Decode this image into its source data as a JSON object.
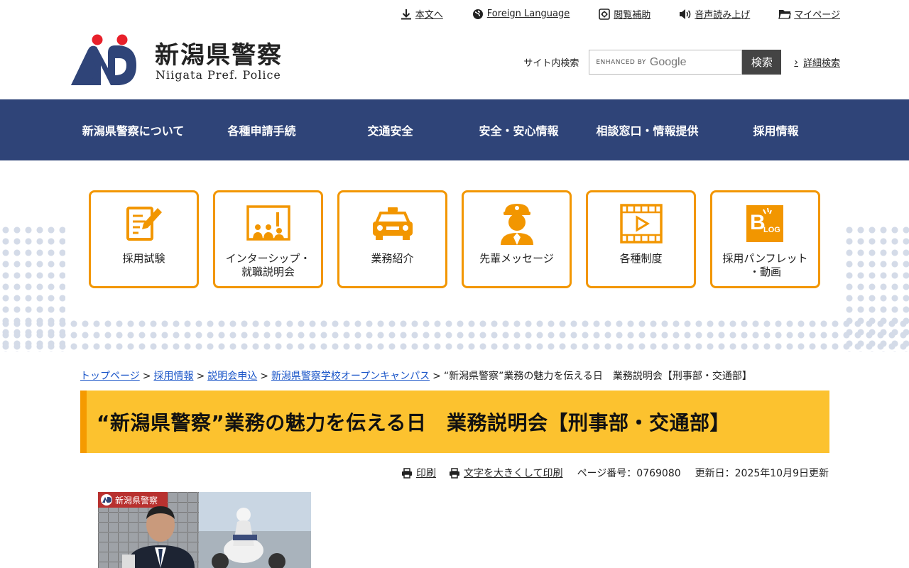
{
  "util_links": [
    {
      "label": "本文へ",
      "icon": "download-arrow-icon"
    },
    {
      "label": "Foreign Language",
      "icon": "globe-icon"
    },
    {
      "label": "閲覧補助",
      "icon": "settings-box-icon"
    },
    {
      "label": "音声読み上げ",
      "icon": "speaker-icon"
    },
    {
      "label": "マイページ",
      "icon": "folder-icon"
    }
  ],
  "logo": {
    "ja": "新潟県警察",
    "en": "Niigata Pref. Police"
  },
  "search": {
    "label": "サイト内検索",
    "enhanced_by": "ENHANCED BY",
    "provider": "Google",
    "button": "検索",
    "advanced": "詳細検索"
  },
  "nav": [
    "新潟県警察について",
    "各種申請手続",
    "交通安全",
    "安全・安心情報",
    "相談窓口・情報提供",
    "採用情報"
  ],
  "menu": [
    {
      "label": "採用試験",
      "icon": "exam-document-icon"
    },
    {
      "label": "インターシップ・\n就職説明会",
      "icon": "presentation-board-icon"
    },
    {
      "label": "業務紹介",
      "icon": "police-car-icon"
    },
    {
      "label": "先輩メッセージ",
      "icon": "police-officer-icon"
    },
    {
      "label": "各種制度",
      "icon": "video-play-icon"
    },
    {
      "label": "採用パンフレット\n・動画",
      "icon": "blog-icon"
    }
  ],
  "breadcrumb": [
    {
      "label": "トップページ",
      "link": true
    },
    {
      "label": "採用情報",
      "link": true
    },
    {
      "label": "説明会申込",
      "link": true
    },
    {
      "label": "新潟県警察学校オープンキャンパス",
      "link": true
    },
    {
      "label": "“新潟県警察”業務の魅力を伝える日　業務説明会【刑事部・交通部】",
      "link": false
    }
  ],
  "page_title": "“新潟県警察”業務の魅力を伝える日　業務説明会【刑事部・交通部】",
  "tools": {
    "print": "印刷",
    "print_large": "文字を大きくして印刷",
    "page_number": "ページ番号：0769080",
    "updated": "更新日：2025年10月9日更新"
  },
  "photo": {
    "badge": "新潟県警察"
  },
  "colors": {
    "nav_bg": "#2f4478",
    "accent_orange": "#f29600",
    "title_bg": "#fcc22f",
    "link": "#1a55c8"
  }
}
